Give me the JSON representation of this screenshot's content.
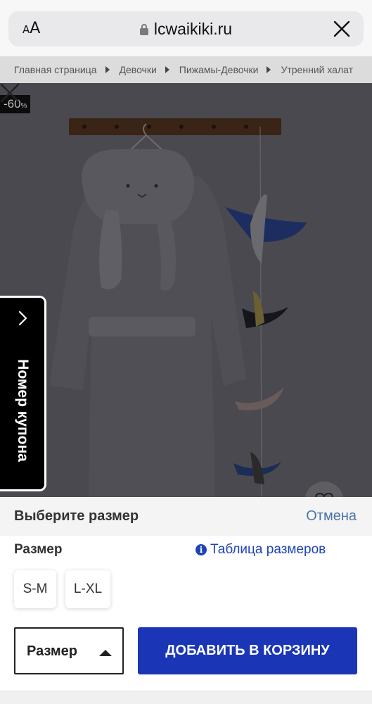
{
  "browser": {
    "text_size_label_small": "A",
    "text_size_label_large": "A",
    "url": "lcwaikiki.ru",
    "lock_icon": "lock-icon",
    "close_icon": "close-icon"
  },
  "breadcrumb": [
    "Главная страница",
    "Девочки",
    "Пижамы-Девочки",
    "Утренний халат"
  ],
  "product": {
    "discount": "-60",
    "discount_unit": "%",
    "favorite_icon": "heart-icon"
  },
  "coupon_tab": {
    "label": "Номер купона",
    "icon": "chevron-right-icon"
  },
  "size_sheet": {
    "title": "Выберите размер",
    "cancel": "Отмена",
    "size_label": "Размер",
    "size_table_link": "Таблица размеров",
    "options": [
      "S-M",
      "L-XL"
    ],
    "select_label": "Размер",
    "add_to_cart": "ДОБАВИТЬ В КОРЗИНУ"
  },
  "colors": {
    "primary_button": "#1a35b5",
    "link": "#1f44b5",
    "cancel": "#4d73a6"
  }
}
